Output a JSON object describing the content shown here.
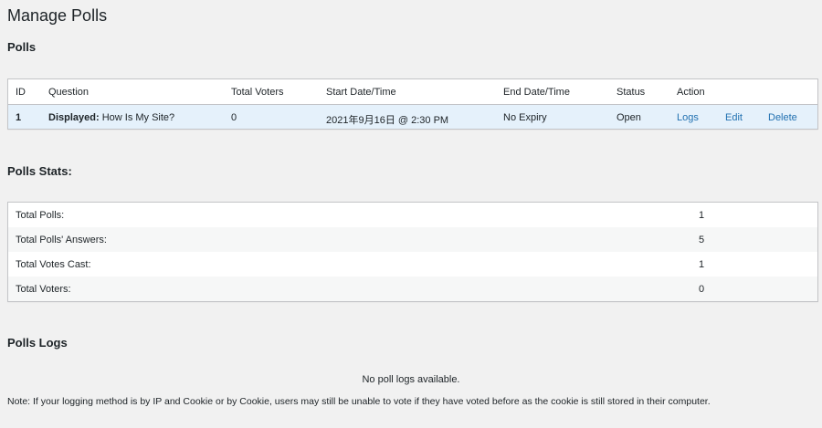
{
  "page_title": "Manage Polls",
  "polls": {
    "heading": "Polls",
    "columns": [
      "ID",
      "Question",
      "Total Voters",
      "Start Date/Time",
      "End Date/Time",
      "Status",
      "Action"
    ],
    "rows": [
      {
        "id": "1",
        "question_prefix": "Displayed:",
        "question": "How Is My Site?",
        "total_voters": "0",
        "start": "2021年9月16日 @ 2:30 PM",
        "end": "No Expiry",
        "status": "Open",
        "actions": {
          "logs": "Logs",
          "edit": "Edit",
          "delete": "Delete"
        }
      }
    ]
  },
  "stats": {
    "heading": "Polls Stats:",
    "rows": [
      {
        "label": "Total Polls:",
        "value": "1"
      },
      {
        "label": "Total Polls' Answers:",
        "value": "5"
      },
      {
        "label": "Total Votes Cast:",
        "value": "1"
      },
      {
        "label": "Total Voters:",
        "value": "0"
      }
    ]
  },
  "logs": {
    "heading": "Polls Logs",
    "empty": "No poll logs available.",
    "note": "Note: If your logging method is by IP and Cookie or by Cookie, users may still be unable to vote if they have voted before as the cookie is still stored in their computer."
  },
  "colors": {
    "link": "#2271b1",
    "row_highlight": "#e5f1fb",
    "background": "#f1f1f1"
  }
}
